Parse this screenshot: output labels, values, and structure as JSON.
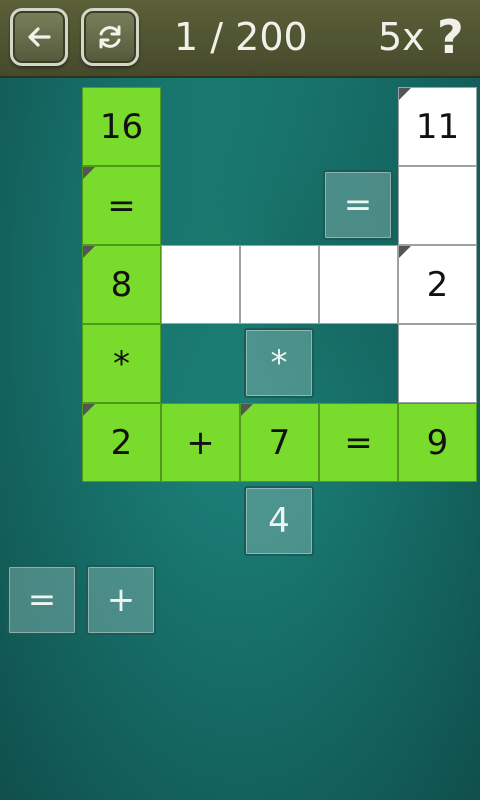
{
  "header": {
    "back_icon": "back-arrow-icon",
    "restart_icon": "refresh-icon",
    "level": "1 / 200",
    "multiplier": "5x",
    "help": "?"
  },
  "board": {
    "cells": {
      "r1c1": "16",
      "r1c5": "11",
      "r2c1": "=",
      "r2c5": "",
      "r3c1": "8",
      "r3c2": "",
      "r3c3": "",
      "r3c4": "",
      "r3c5": "2",
      "r4c1": "*",
      "r4c5": "",
      "r5c1": "2",
      "r5c2": "+",
      "r5c3": "7",
      "r5c4": "=",
      "r5c5": "9"
    }
  },
  "tiles": {
    "board_eq": "=",
    "board_mul": "*",
    "below_4": "4",
    "tray_eq": "=",
    "tray_plus": "+"
  }
}
